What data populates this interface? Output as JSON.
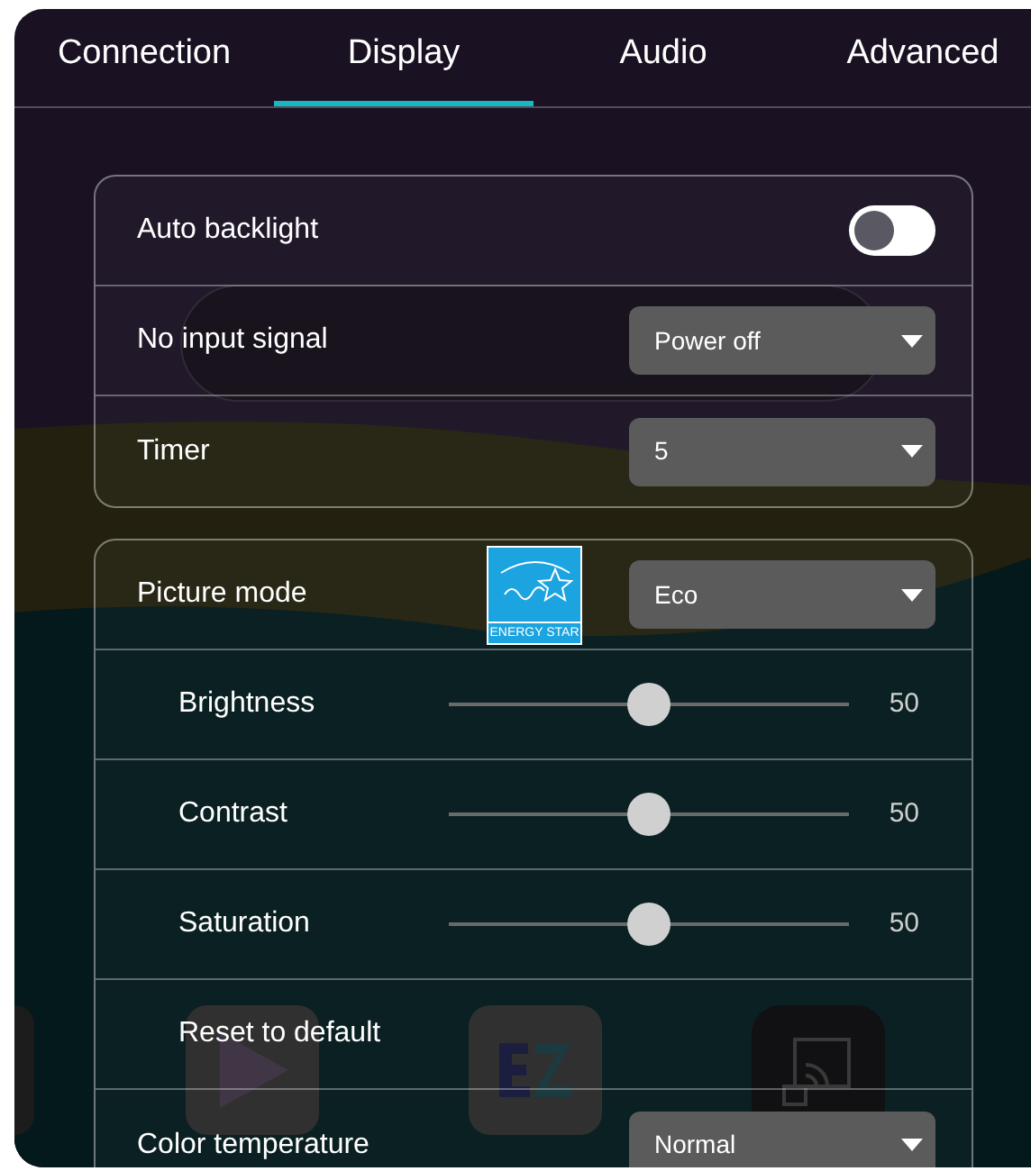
{
  "tabs": [
    {
      "label": "Connection",
      "selected": false
    },
    {
      "label": "Display",
      "selected": true
    },
    {
      "label": "Audio",
      "selected": false
    },
    {
      "label": "Advanced",
      "selected": false
    }
  ],
  "background": {
    "apps": [
      {
        "kind": "play"
      },
      {
        "kind": "ezwrite"
      },
      {
        "kind": "cast"
      }
    ]
  },
  "power_group": [
    {
      "kind": "toggle",
      "label": "Auto backlight",
      "on": false
    },
    {
      "kind": "dropdown",
      "label": "No input signal",
      "value": "Power off"
    },
    {
      "kind": "dropdown",
      "label": "Timer",
      "value": "5"
    }
  ],
  "picture_group": [
    {
      "kind": "dropdown",
      "label": "Picture mode",
      "value": "Eco",
      "badge": "ENERGY STAR"
    },
    {
      "kind": "slider",
      "label": "Brightness",
      "level": 0.5,
      "reading": "50"
    },
    {
      "kind": "slider",
      "label": "Contrast",
      "level": 0.5,
      "reading": "50"
    },
    {
      "kind": "slider",
      "label": "Saturation",
      "level": 0.5,
      "reading": "50"
    },
    {
      "kind": "action",
      "label": "Reset to default"
    },
    {
      "kind": "dropdown",
      "label": "Color temperature",
      "value": "Normal"
    }
  ]
}
